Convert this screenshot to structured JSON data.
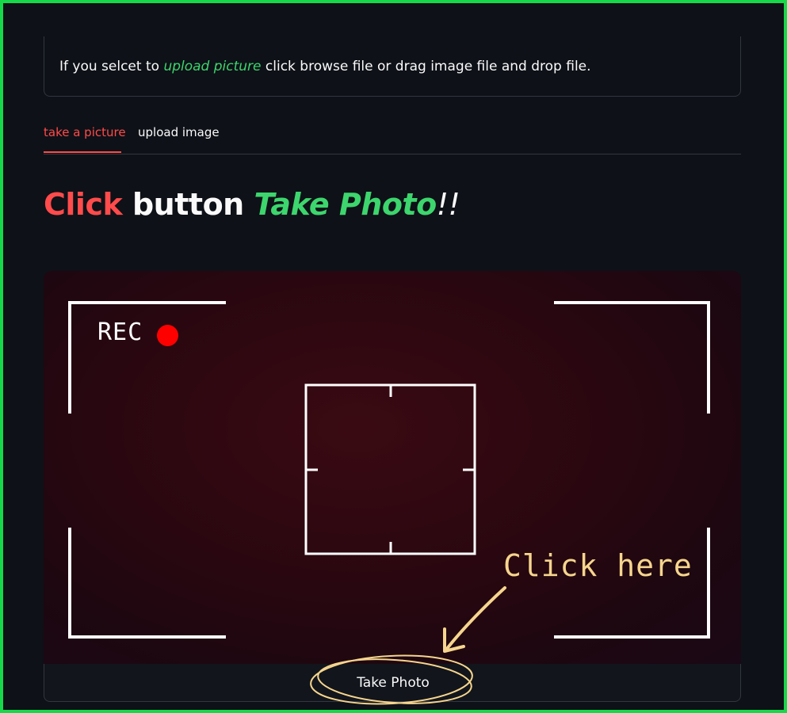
{
  "info": {
    "text_before": "If you selcet to ",
    "highlight": "upload picture",
    "text_after": " click browse file or drag image file and drop file."
  },
  "tabs": [
    {
      "label": "take a picture",
      "active": true
    },
    {
      "label": "upload image",
      "active": false
    }
  ],
  "heading": {
    "part1": "Click",
    "part2": " button ",
    "part3": "Take Photo",
    "part4": "!!"
  },
  "camera": {
    "rec_label": "REC",
    "annotation": "Click here"
  },
  "button": {
    "label": "Take Photo"
  },
  "colors": {
    "accent_red": "#ff4b4b",
    "accent_green": "#3dd56d",
    "annotation_yellow": "#f6d58e",
    "frame_green": "#16d94a"
  }
}
